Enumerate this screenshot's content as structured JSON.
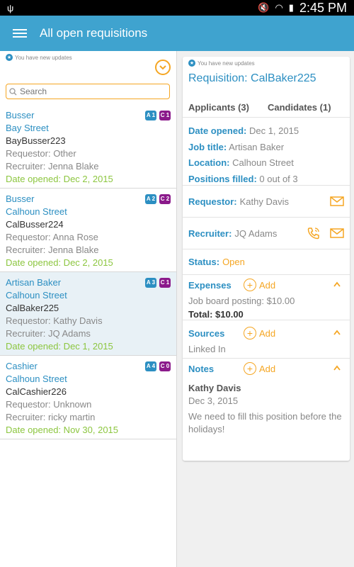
{
  "status_bar": {
    "time": "2:45 PM"
  },
  "app_bar": {
    "title": "All open requisitions"
  },
  "left_pane": {
    "update_note": "You have new updates",
    "search_placeholder": "Search",
    "requisitions": [
      {
        "title": "Busser",
        "street": "Bay Street",
        "code": "BayBusser223",
        "requestor": "Requestor: Other",
        "recruiter": "Recruiter: Jenna Blake",
        "date": "Date opened: Dec 2, 2015",
        "badge_a": "A 1",
        "badge_c": "C 1"
      },
      {
        "title": "Busser",
        "street": "Calhoun Street",
        "code": "CalBusser224",
        "requestor": "Requestor: Anna Rose",
        "recruiter": "Recruiter: Jenna Blake",
        "date": "Date opened: Dec 2, 2015",
        "badge_a": "A 2",
        "badge_c": "C 2"
      },
      {
        "title": "Artisan Baker",
        "street": "Calhoun Street",
        "code": "CalBaker225",
        "requestor": "Requestor: Kathy Davis",
        "recruiter": "Recruiter: JQ Adams",
        "date": "Date opened: Dec 1, 2015",
        "badge_a": "A 3",
        "badge_c": "C 1"
      },
      {
        "title": "Cashier",
        "street": "Calhoun Street",
        "code": "CalCashier226",
        "requestor": "Requestor: Unknown",
        "recruiter": "Recruiter: ricky martin",
        "date": "Date opened: Nov 30, 2015",
        "badge_a": "A 4",
        "badge_c": "C 0"
      }
    ]
  },
  "detail": {
    "update_note": "You have new updates",
    "title": "Requisition: CalBaker225",
    "tabs": [
      "Applicants (3)",
      "Candidates (1)"
    ],
    "date_opened_label": "Date opened:",
    "date_opened": "Dec 1, 2015",
    "job_title_label": "Job title:",
    "job_title": "Artisan Baker",
    "location_label": "Location:",
    "location": "Calhoun Street",
    "positions_label": "Positions filled:",
    "positions": "0 out of 3",
    "requestor_label": "Requestor:",
    "requestor": "Kathy Davis",
    "recruiter_label": "Recruiter:",
    "recruiter": "JQ Adams",
    "status_label": "Status:",
    "status": "Open",
    "expenses_label": "Expenses",
    "add_label": "Add",
    "expense_item": "Job board posting: $10.00",
    "expense_total": "Total: $10.00",
    "sources_label": "Sources",
    "source_item": "Linked In",
    "notes_label": "Notes",
    "note_author": "Kathy Davis",
    "note_date": "Dec 3, 2015",
    "note_text": "We need to fill this position before the holidays!"
  },
  "colors": {
    "accent_blue": "#2c8fc2",
    "appbar": "#3fa3cf",
    "orange": "#f5a623",
    "green": "#8cc63f",
    "purple": "#8b1a8b"
  }
}
